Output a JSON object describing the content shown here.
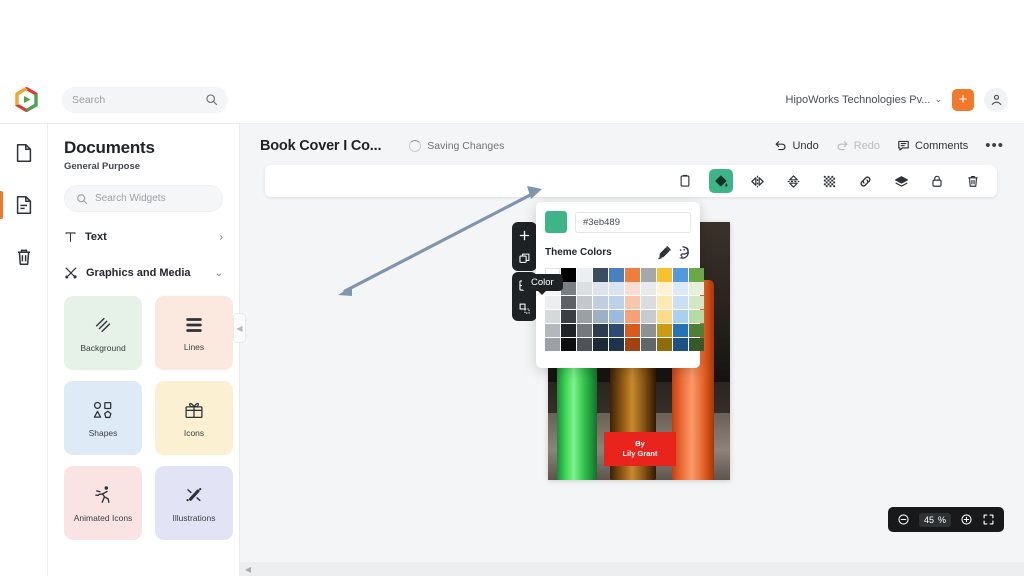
{
  "brand": {
    "logo_name": "app-logo",
    "accent": "#f2792b"
  },
  "topbar": {
    "search": {
      "placeholder": "Search",
      "value": ""
    },
    "org": {
      "label": "HipoWorks Technologies Pv...",
      "chevron": "⌄"
    },
    "add_label": "+",
    "avatar_name": "account-avatar"
  },
  "rail": {
    "items": [
      {
        "name": "pages-icon",
        "active": false
      },
      {
        "name": "document-icon",
        "active": true
      },
      {
        "name": "trash-icon",
        "active": false
      }
    ]
  },
  "sidebar": {
    "title": "Documents",
    "subtitle": "General Purpose",
    "search": {
      "placeholder": "Search Widgets",
      "value": ""
    },
    "sections": [
      {
        "label": "Text",
        "icon": "text-icon",
        "expanded": false,
        "arrow": "›"
      },
      {
        "label": "Graphics and Media",
        "icon": "graphics-icon",
        "expanded": true,
        "arrow": "⌄"
      }
    ],
    "cards": [
      {
        "label": "Background",
        "icon": "background-icon",
        "bg": "#e6f1e7"
      },
      {
        "label": "Lines",
        "icon": "lines-icon",
        "bg": "#fbe8de"
      },
      {
        "label": "Shapes",
        "icon": "shapes-icon",
        "bg": "#dfeaf7"
      },
      {
        "label": "Icons",
        "icon": "gift-icon",
        "bg": "#fbf0d2"
      },
      {
        "label": "Animated Icons",
        "icon": "running-person-icon",
        "bg": "#fae3e3"
      },
      {
        "label": "Illustrations",
        "icon": "illustrations-icon",
        "bg": "#e3e3f6"
      }
    ]
  },
  "document": {
    "title": "Book Cover I Co...",
    "status": "Saving Changes",
    "actions": [
      {
        "label": "Undo",
        "icon": "undo-icon",
        "disabled": false
      },
      {
        "label": "Redo",
        "icon": "redo-icon",
        "disabled": true
      },
      {
        "label": "Comments",
        "icon": "comments-icon",
        "disabled": false
      }
    ],
    "more_label": "•••"
  },
  "element_toolbar": {
    "tooltip": "Color",
    "buttons": [
      {
        "name": "duplicate-icon",
        "selected": false
      },
      {
        "name": "color-fill-icon",
        "selected": true
      },
      {
        "name": "flip-horizontal-icon",
        "selected": false
      },
      {
        "name": "flip-vertical-icon",
        "selected": false
      },
      {
        "name": "transparency-icon",
        "selected": false
      },
      {
        "name": "link-icon",
        "selected": false
      },
      {
        "name": "layers-icon",
        "selected": false
      },
      {
        "name": "lock-icon",
        "selected": false
      },
      {
        "name": "delete-icon",
        "selected": false
      }
    ]
  },
  "color_picker": {
    "hex": "#3eb489",
    "swatch": "#3eb489",
    "theme_label": "Theme Colors",
    "tools": [
      {
        "name": "eyedropper-icon"
      },
      {
        "name": "color-wheel-icon"
      }
    ],
    "palette": [
      [
        "#ffffff",
        "#000000",
        "#eceff1",
        "#3b4d61",
        "#4a7fc1",
        "#ef7d3b",
        "#a3a8ad",
        "#fbc02d",
        "#5599dd",
        "#6aaa46"
      ],
      [
        "#f4f5f6",
        "#7a7f84",
        "#dcdfe2",
        "#dde4ec",
        "#d9e4f3",
        "#fbded0",
        "#e8eaec",
        "#fef2d2",
        "#dceaf7",
        "#e4f0dc"
      ],
      [
        "#eceef0",
        "#5e6267",
        "#c4c8cc",
        "#c2cedd",
        "#bcd2ea",
        "#f9c5ab",
        "#dadde0",
        "#fde9b4",
        "#c9e0f3",
        "#d2e7c4"
      ],
      [
        "#d6d9dc",
        "#3b3f44",
        "#9ba0a5",
        "#9db0c6",
        "#9abae0",
        "#f6a073",
        "#c8cccf",
        "#fcdc86",
        "#a9d0ee",
        "#b6dba4"
      ],
      [
        "#b4b8bc",
        "#1f2226",
        "#74797e",
        "#2c3b4d",
        "#2b4a74",
        "#d95b1b",
        "#8c9196",
        "#cc9b13",
        "#2572b5",
        "#4e7f37"
      ],
      [
        "#9da1a5",
        "#0c0e10",
        "#4e5358",
        "#1d2935",
        "#1d3350",
        "#a2420f",
        "#61666b",
        "#8f6c0c",
        "#1b5185",
        "#37582a"
      ]
    ]
  },
  "canvas_tools": {
    "top": [
      {
        "name": "add-page-icon"
      },
      {
        "name": "duplicate-page-icon"
      }
    ],
    "bottom": [
      {
        "name": "grid-layout-icon"
      },
      {
        "name": "crop-icon"
      }
    ]
  },
  "cover": {
    "byline_prefix": "By",
    "author": "Lily Grant",
    "byline_bg": "#e8241c"
  },
  "zoom_control": {
    "minus": "−",
    "value": "45",
    "unit": "%",
    "plus": "+",
    "fullscreen_name": "fullscreen-icon"
  }
}
